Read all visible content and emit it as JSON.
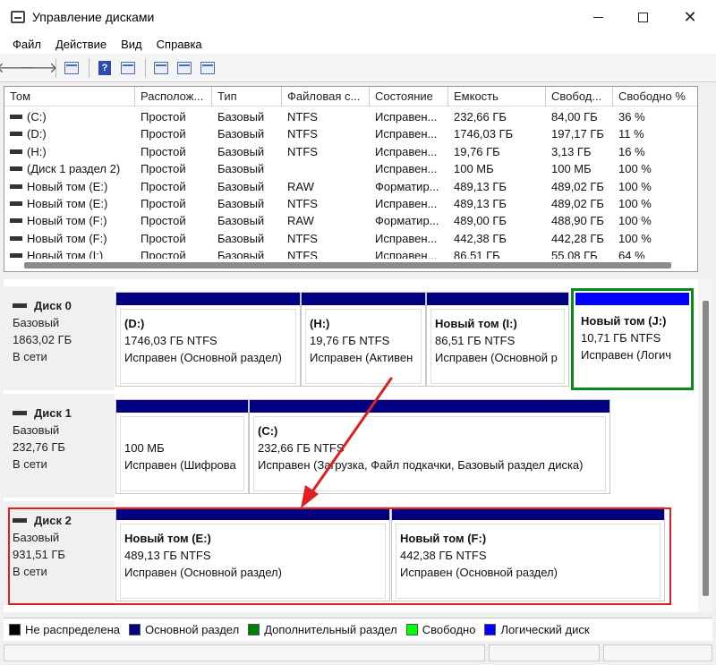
{
  "window": {
    "title": "Управление дисками",
    "close_glyph": "✕"
  },
  "menu": [
    "Файл",
    "Действие",
    "Вид",
    "Справка"
  ],
  "toolbar": {
    "back": "🡐",
    "forward": "🡒",
    "help": "?"
  },
  "columns": [
    "Том",
    "Располож...",
    "Тип",
    "Файловая с...",
    "Состояние",
    "Емкость",
    "Свобод...",
    "Свободно %"
  ],
  "rows": [
    [
      "(C:)",
      "Простой",
      "Базовый",
      "NTFS",
      "Исправен...",
      "232,66 ГБ",
      "84,00 ГБ",
      "36 %"
    ],
    [
      "(D:)",
      "Простой",
      "Базовый",
      "NTFS",
      "Исправен...",
      "1746,03 ГБ",
      "197,17 ГБ",
      "11 %"
    ],
    [
      "(H:)",
      "Простой",
      "Базовый",
      "NTFS",
      "Исправен...",
      "19,76 ГБ",
      "3,13 ГБ",
      "16 %"
    ],
    [
      "(Диск 1 раздел 2)",
      "Простой",
      "Базовый",
      "",
      "Исправен...",
      "100 МБ",
      "100 МБ",
      "100 %"
    ],
    [
      "Новый том (E:)",
      "Простой",
      "Базовый",
      "RAW",
      "Форматир...",
      "489,13 ГБ",
      "489,02 ГБ",
      "100 %"
    ],
    [
      "Новый том (E:)",
      "Простой",
      "Базовый",
      "NTFS",
      "Исправен...",
      "489,13 ГБ",
      "489,02 ГБ",
      "100 %"
    ],
    [
      "Новый том (F:)",
      "Простой",
      "Базовый",
      "RAW",
      "Форматир...",
      "489,00 ГБ",
      "488,90 ГБ",
      "100 %"
    ],
    [
      "Новый том (F:)",
      "Простой",
      "Базовый",
      "NTFS",
      "Исправен...",
      "442,38 ГБ",
      "442,28 ГБ",
      "100 %"
    ],
    [
      "Новый том (I:)",
      "Простой",
      "Базовый",
      "NTFS",
      "Исправен...",
      "86,51 ГБ",
      "55,08 ГБ",
      "64 %"
    ]
  ],
  "disks": [
    {
      "name": "Диск 0",
      "type": "Базовый",
      "size": "1863,02 ГБ",
      "status": "В сети",
      "partitions": [
        {
          "title": "(D:)",
          "line1": "1746,03 ГБ NTFS",
          "line2": "Исправен (Основной раздел)"
        },
        {
          "title": "(H:)",
          "line1": "19,76 ГБ NTFS",
          "line2": "Исправен (Активен"
        },
        {
          "title": "Новый том  (I:)",
          "line1": "86,51 ГБ NTFS",
          "line2": "Исправен (Основной р"
        },
        {
          "title": "Новый том  (J:)",
          "line1": "10,71 ГБ NTFS",
          "line2": "Исправен (Логич"
        }
      ]
    },
    {
      "name": "Диск 1",
      "type": "Базовый",
      "size": "232,76 ГБ",
      "status": "В сети",
      "partitions": [
        {
          "title": "",
          "line1": "100 МБ",
          "line2": "Исправен (Шифрова"
        },
        {
          "title": "(C:)",
          "line1": "232,66 ГБ NTFS",
          "line2": "Исправен (Загрузка, Файл подкачки, Базовый раздел диска)"
        }
      ]
    },
    {
      "name": "Диск 2",
      "type": "Базовый",
      "size": "931,51 ГБ",
      "status": "В сети",
      "partitions": [
        {
          "title": "Новый том  (E:)",
          "line1": "489,13 ГБ NTFS",
          "line2": "Исправен (Основной раздел)"
        },
        {
          "title": "Новый том  (F:)",
          "line1": "442,38 ГБ NTFS",
          "line2": "Исправен (Основной раздел)"
        }
      ]
    }
  ],
  "legend": [
    {
      "label": "Не распределена",
      "color": "#000000"
    },
    {
      "label": "Основной раздел",
      "color": "#000080"
    },
    {
      "label": "Дополнительный раздел",
      "color": "#008000"
    },
    {
      "label": "Свободно",
      "color": "#00ff00"
    },
    {
      "label": "Логический диск",
      "color": "#0000ff"
    }
  ],
  "colors": {
    "primary": "#000080",
    "logical": "#0000ff",
    "selection": "#0a8a1a",
    "annotation": "#e02020"
  }
}
